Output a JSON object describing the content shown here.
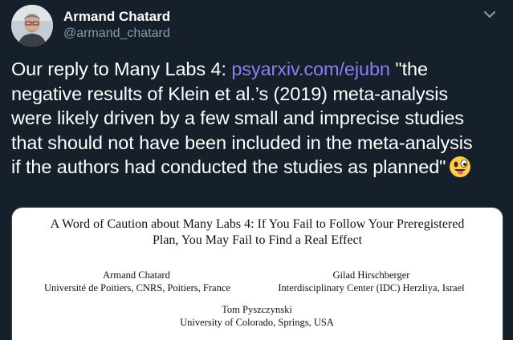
{
  "author": {
    "name": "Armand Chatard",
    "handle": "@armand_chatard"
  },
  "tweet": {
    "line1_before": "Our reply to Many Labs 4: ",
    "link": "psyarxiv.com/ejubn",
    "line1_after": " \"the",
    "line2": "negative results of Klein et al.’s (2019) meta-analysis",
    "line3": "were likely driven by a few small and imprecise studies",
    "line4": "that should not have been included in the meta-analysis",
    "line5": "if the authors had conducted the studies as planned\"",
    "emoji": "winking-face-with-tongue-icon"
  },
  "paper": {
    "title_line1": "A Word of Caution about Many Labs 4: If You Fail to Follow Your Preregistered",
    "title_line2": "Plan, You May Fail to Find a Real Effect",
    "authors": [
      {
        "name": "Armand Chatard",
        "affiliation": "Université de Poitiers, CNRS, Poitiers, France"
      },
      {
        "name": "Gilad Hirschberger",
        "affiliation": "Interdisciplinary Center (IDC) Herzliya, Israel"
      },
      {
        "name": "Tom Pyszczynski",
        "affiliation": "University of Colorado, Springs, USA"
      }
    ]
  },
  "colors": {
    "background": "#15202b",
    "link": "#8a7df5",
    "secondary_text": "#8899a6"
  }
}
